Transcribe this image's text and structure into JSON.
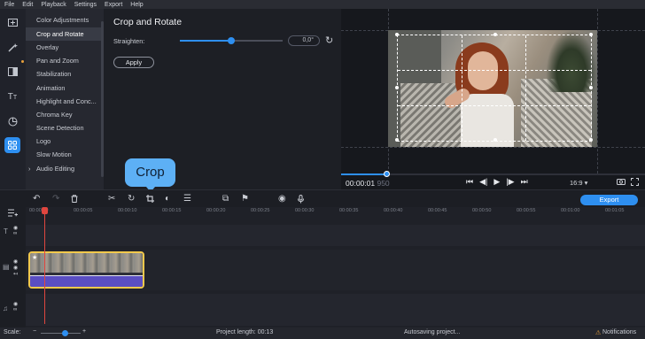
{
  "menubar": [
    "File",
    "Edit",
    "Playback",
    "Settings",
    "Export",
    "Help"
  ],
  "tools_menu": {
    "items": [
      "Color Adjustments",
      "Crop and Rotate",
      "Overlay",
      "Pan and Zoom",
      "Stabilization",
      "Animation",
      "Highlight and Conc...",
      "Chroma Key",
      "Scene Detection",
      "Logo",
      "Slow Motion",
      "Audio Editing"
    ],
    "selected": "Crop and Rotate",
    "expand_glyph": "›"
  },
  "panel": {
    "title": "Crop and Rotate",
    "straighten_label": "Straighten:",
    "straighten_value": "0,0°",
    "straighten_level": 0.5,
    "reset_icon": "↻",
    "apply_label": "Apply"
  },
  "tooltip": {
    "text": "Crop"
  },
  "player": {
    "time_current": "00:00:01",
    "time_frames": "950",
    "progress": 0.15,
    "aspect": "16:9 ▾",
    "controls": [
      "⏮",
      "◀|",
      "▶",
      "|▶",
      "⏭"
    ],
    "icons": [
      "📷",
      "⤢"
    ]
  },
  "toolbar": {
    "export_label": "Export",
    "icons": [
      "↶",
      "↷",
      "🗑",
      "✂",
      "↻",
      "⧉",
      "◐",
      "☰",
      "⧉",
      "⚑",
      "◉",
      "🎤"
    ]
  },
  "ruler": [
    "00:00:00",
    "00:00:05",
    "00:00:10",
    "00:00:15",
    "00:00:20",
    "00:00:25",
    "00:00:30",
    "00:00:35",
    "00:00:40",
    "00:00:45",
    "00:00:50",
    "00:00:55",
    "00:01:00",
    "00:01:05"
  ],
  "statusbar": {
    "scale_label": "Scale:",
    "minus": "−",
    "plus": "+",
    "project_length": "Project length:  00:13",
    "autosave": "Autosaving project...",
    "notifications": "Notifications"
  },
  "colors": {
    "accent": "#2e8ff0",
    "clip_border": "#f2c94c",
    "playhead": "#e0463f",
    "tooltip": "#5db0f5"
  }
}
